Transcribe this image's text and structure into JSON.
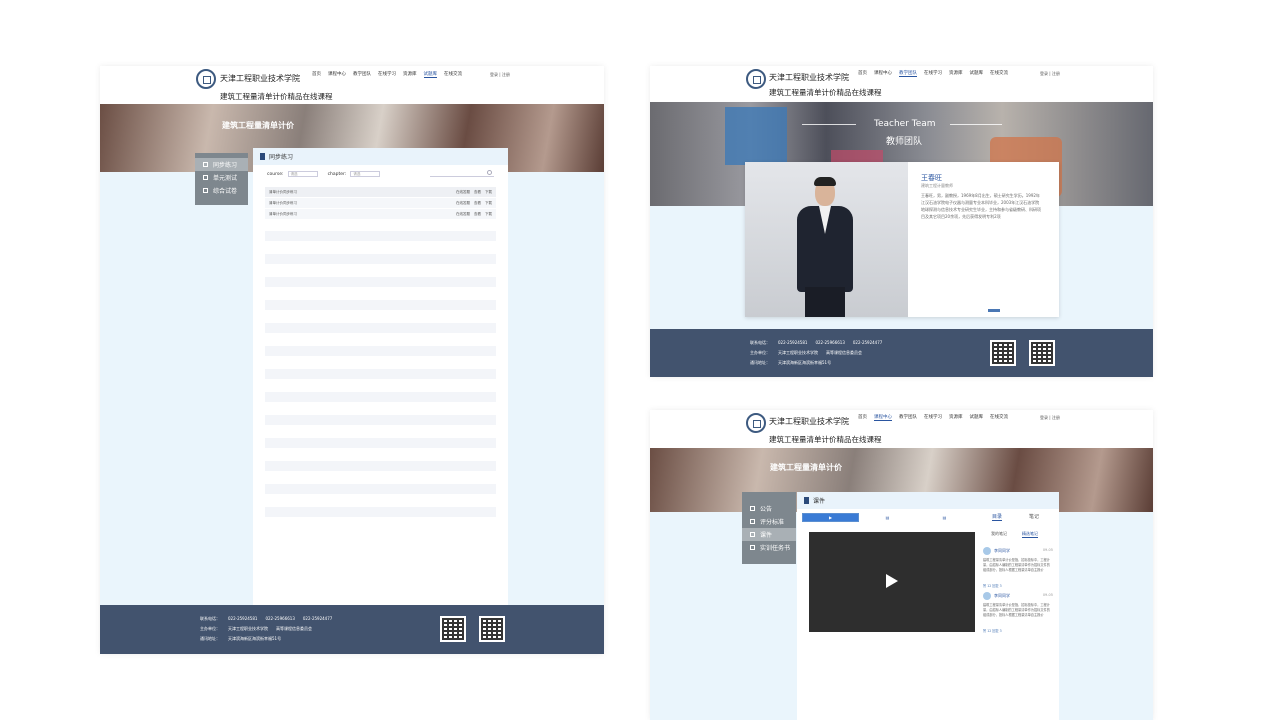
{
  "school": "天津工程职业技术学院",
  "course_title": "建筑工程量清单计价精品在线课程",
  "banner_title": "建筑工程量清单计价",
  "login": "登录 | 注册",
  "nav": [
    "首页",
    "课程中心",
    "教学团队",
    "在线学习",
    "资源库",
    "试题库",
    "在线交流"
  ],
  "exercise_page": {
    "sidebar": [
      "同步练习",
      "单元测试",
      "综合试卷"
    ],
    "panel_title": "同步练习",
    "filter": {
      "course_label": "course:",
      "chapter_label": "chapter:",
      "course_placeholder": "请选",
      "chapter_placeholder": "请选"
    },
    "rows": [
      {
        "name": "清单计价同步练习",
        "actions": [
          "在线答题",
          "查看",
          "下载"
        ]
      },
      {
        "name": "清单计价同步练习",
        "actions": [
          "在线答题",
          "查看",
          "下载"
        ]
      },
      {
        "name": "清单计价同步练习",
        "actions": [
          "在线答题",
          "查看",
          "下载"
        ]
      }
    ]
  },
  "footer": {
    "phone_label": "联系电话：",
    "phones": [
      "022-25924581",
      "022-25966613",
      "022-25924477"
    ],
    "org_label": "主办单位：",
    "orgs": [
      "天津工程职业技术学院",
      "高等课程信息委员会"
    ],
    "addr_label": "通讯地址：",
    "addr": "天津滨海新区海滨街幸福51号"
  },
  "team_page": {
    "title_en": "Teacher Team",
    "title_cn": "教师团队",
    "teacher_name": "王春旺",
    "teacher_role": "建筑工程计量教师",
    "teacher_bio": "王春旺，男，副教授，1969年8月出生，硕士研究生学历。1992年江汉石油学院电子仪器与测量专业本科毕业，2003年江汉石油学院地球探测与信息技术专业研究生毕业，主持和参与省级教研、科研项目及其它项目20余项，先后获得发明专利2项"
  },
  "course_page": {
    "sidebar": [
      "公告",
      "评分标准",
      "课件",
      "实训任务书"
    ],
    "panel_title": "课件",
    "notes_tabs": [
      "目录",
      "笔记"
    ],
    "notes_subtabs": [
      "我的笔记",
      "精选笔记"
    ],
    "notes": [
      {
        "user": "李同同学",
        "time": "09-05",
        "text": "建筑工程量清单计价是指，招标投标中，工程计量，由招标人编制的工程量清单作为招标文件的组成部分，投标人根据工程量清单自主报价",
        "meta": "赞 12  回复 3"
      },
      {
        "user": "李同同学",
        "time": "09-05",
        "text": "建筑工程量清单计价是指，招标投标中，工程计量，由招标人编制的工程量清单作为招标文件的组成部分，投标人根据工程量清单自主报价",
        "meta": "赞 12  回复 3"
      }
    ]
  }
}
